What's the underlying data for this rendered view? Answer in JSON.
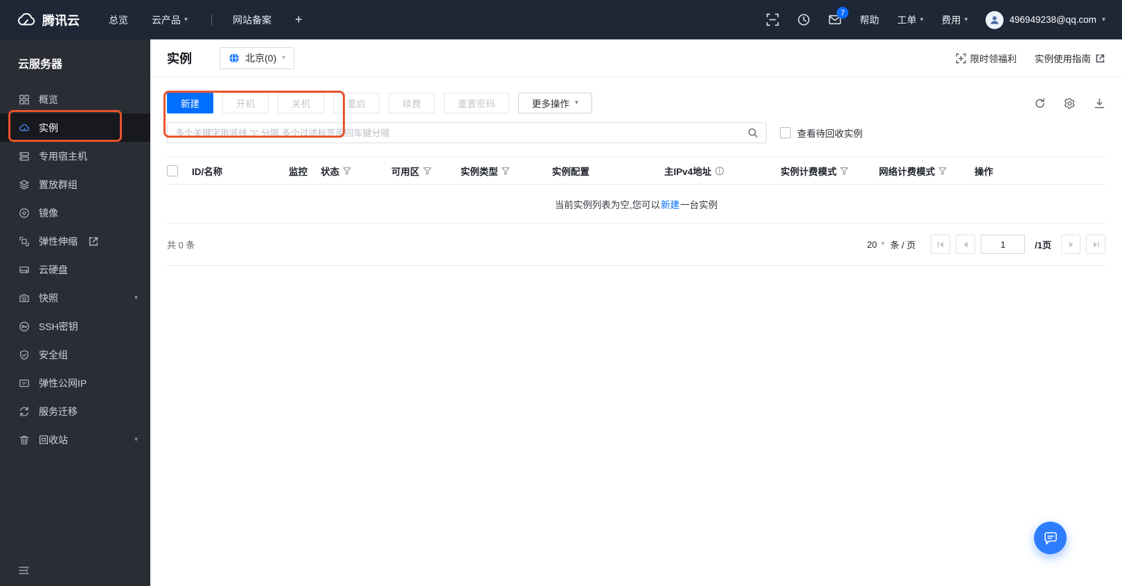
{
  "topbar": {
    "brand": "腾讯云",
    "nav_overview": "总览",
    "nav_products": "云产品",
    "nav_icp": "网站备案",
    "nav_add": "+",
    "badge_count": "7",
    "help": "帮助",
    "ticket": "工单",
    "billing": "费用",
    "account": "496949238@qq.com"
  },
  "sidebar": {
    "title": "云服务器",
    "items": [
      {
        "label": "概览"
      },
      {
        "label": "实例"
      },
      {
        "label": "专用宿主机"
      },
      {
        "label": "置放群组"
      },
      {
        "label": "镜像"
      },
      {
        "label": "弹性伸缩"
      },
      {
        "label": "云硬盘"
      },
      {
        "label": "快照"
      },
      {
        "label": "SSH密钥"
      },
      {
        "label": "安全组"
      },
      {
        "label": "弹性公网IP"
      },
      {
        "label": "服务迁移"
      },
      {
        "label": "回收站"
      }
    ]
  },
  "header": {
    "title": "实例",
    "region": "北京(0)",
    "promo": "限时领福利",
    "guide": "实例使用指南"
  },
  "toolbar": {
    "new": "新建",
    "start": "开机",
    "shutdown": "关机",
    "restart": "重启",
    "renew": "续费",
    "reset_password": "重置密码",
    "more": "更多操作",
    "search_placeholder": "多个关键字用竖线 \"|\" 分隔,多个过滤标签用回车键分隔",
    "recycle_label": "查看待回收实例"
  },
  "table": {
    "columns": [
      {
        "label": "ID/名称"
      },
      {
        "label": "监控"
      },
      {
        "label": "状态"
      },
      {
        "label": "可用区"
      },
      {
        "label": "实例类型"
      },
      {
        "label": "实例配置"
      },
      {
        "label": "主IPv4地址"
      },
      {
        "label": "实例计费模式"
      },
      {
        "label": "网络计费模式"
      },
      {
        "label": "操作"
      }
    ],
    "empty_prefix": "当前实例列表为空,您可以",
    "empty_link": "新建",
    "empty_suffix": "一台实例"
  },
  "pagination": {
    "total": "共 0 条",
    "page_size": "20",
    "per_page": "条 / 页",
    "page": "1",
    "page_total": "/1页"
  },
  "colors": {
    "accent_blue": "#006eff",
    "annotation_orange": "#e8532c",
    "topbar_bg": "#1e2736",
    "sidebar_bg": "#2a2d34"
  },
  "icons": {
    "caret": "▾"
  }
}
